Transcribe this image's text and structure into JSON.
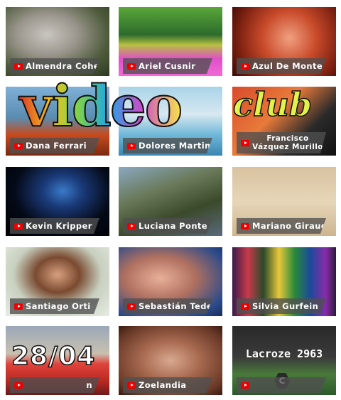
{
  "logo": {
    "video_text": "video",
    "club_text": "club"
  },
  "tiles": [
    {
      "name": "Almendra Cohen"
    },
    {
      "name": "Ariel Cusnir"
    },
    {
      "name": "Azul De Monte"
    },
    {
      "name": "Dana Ferrari"
    },
    {
      "name": "Dolores Martin"
    },
    {
      "name": "Francisco Vázquez Murillo"
    },
    {
      "name": "Kevin Kripper"
    },
    {
      "name": "Luciana Ponte"
    },
    {
      "name": "Mariano Giraud"
    },
    {
      "name": "Santiago Orti"
    },
    {
      "name": "Sebastián Tedesco"
    },
    {
      "name": "Silvia Gurfein"
    },
    {
      "name": "n",
      "overlay": "28/04"
    },
    {
      "name": "Zoelandia"
    },
    {
      "name": "",
      "overlay": "Lacroze 2963",
      "badge": "C"
    }
  ]
}
